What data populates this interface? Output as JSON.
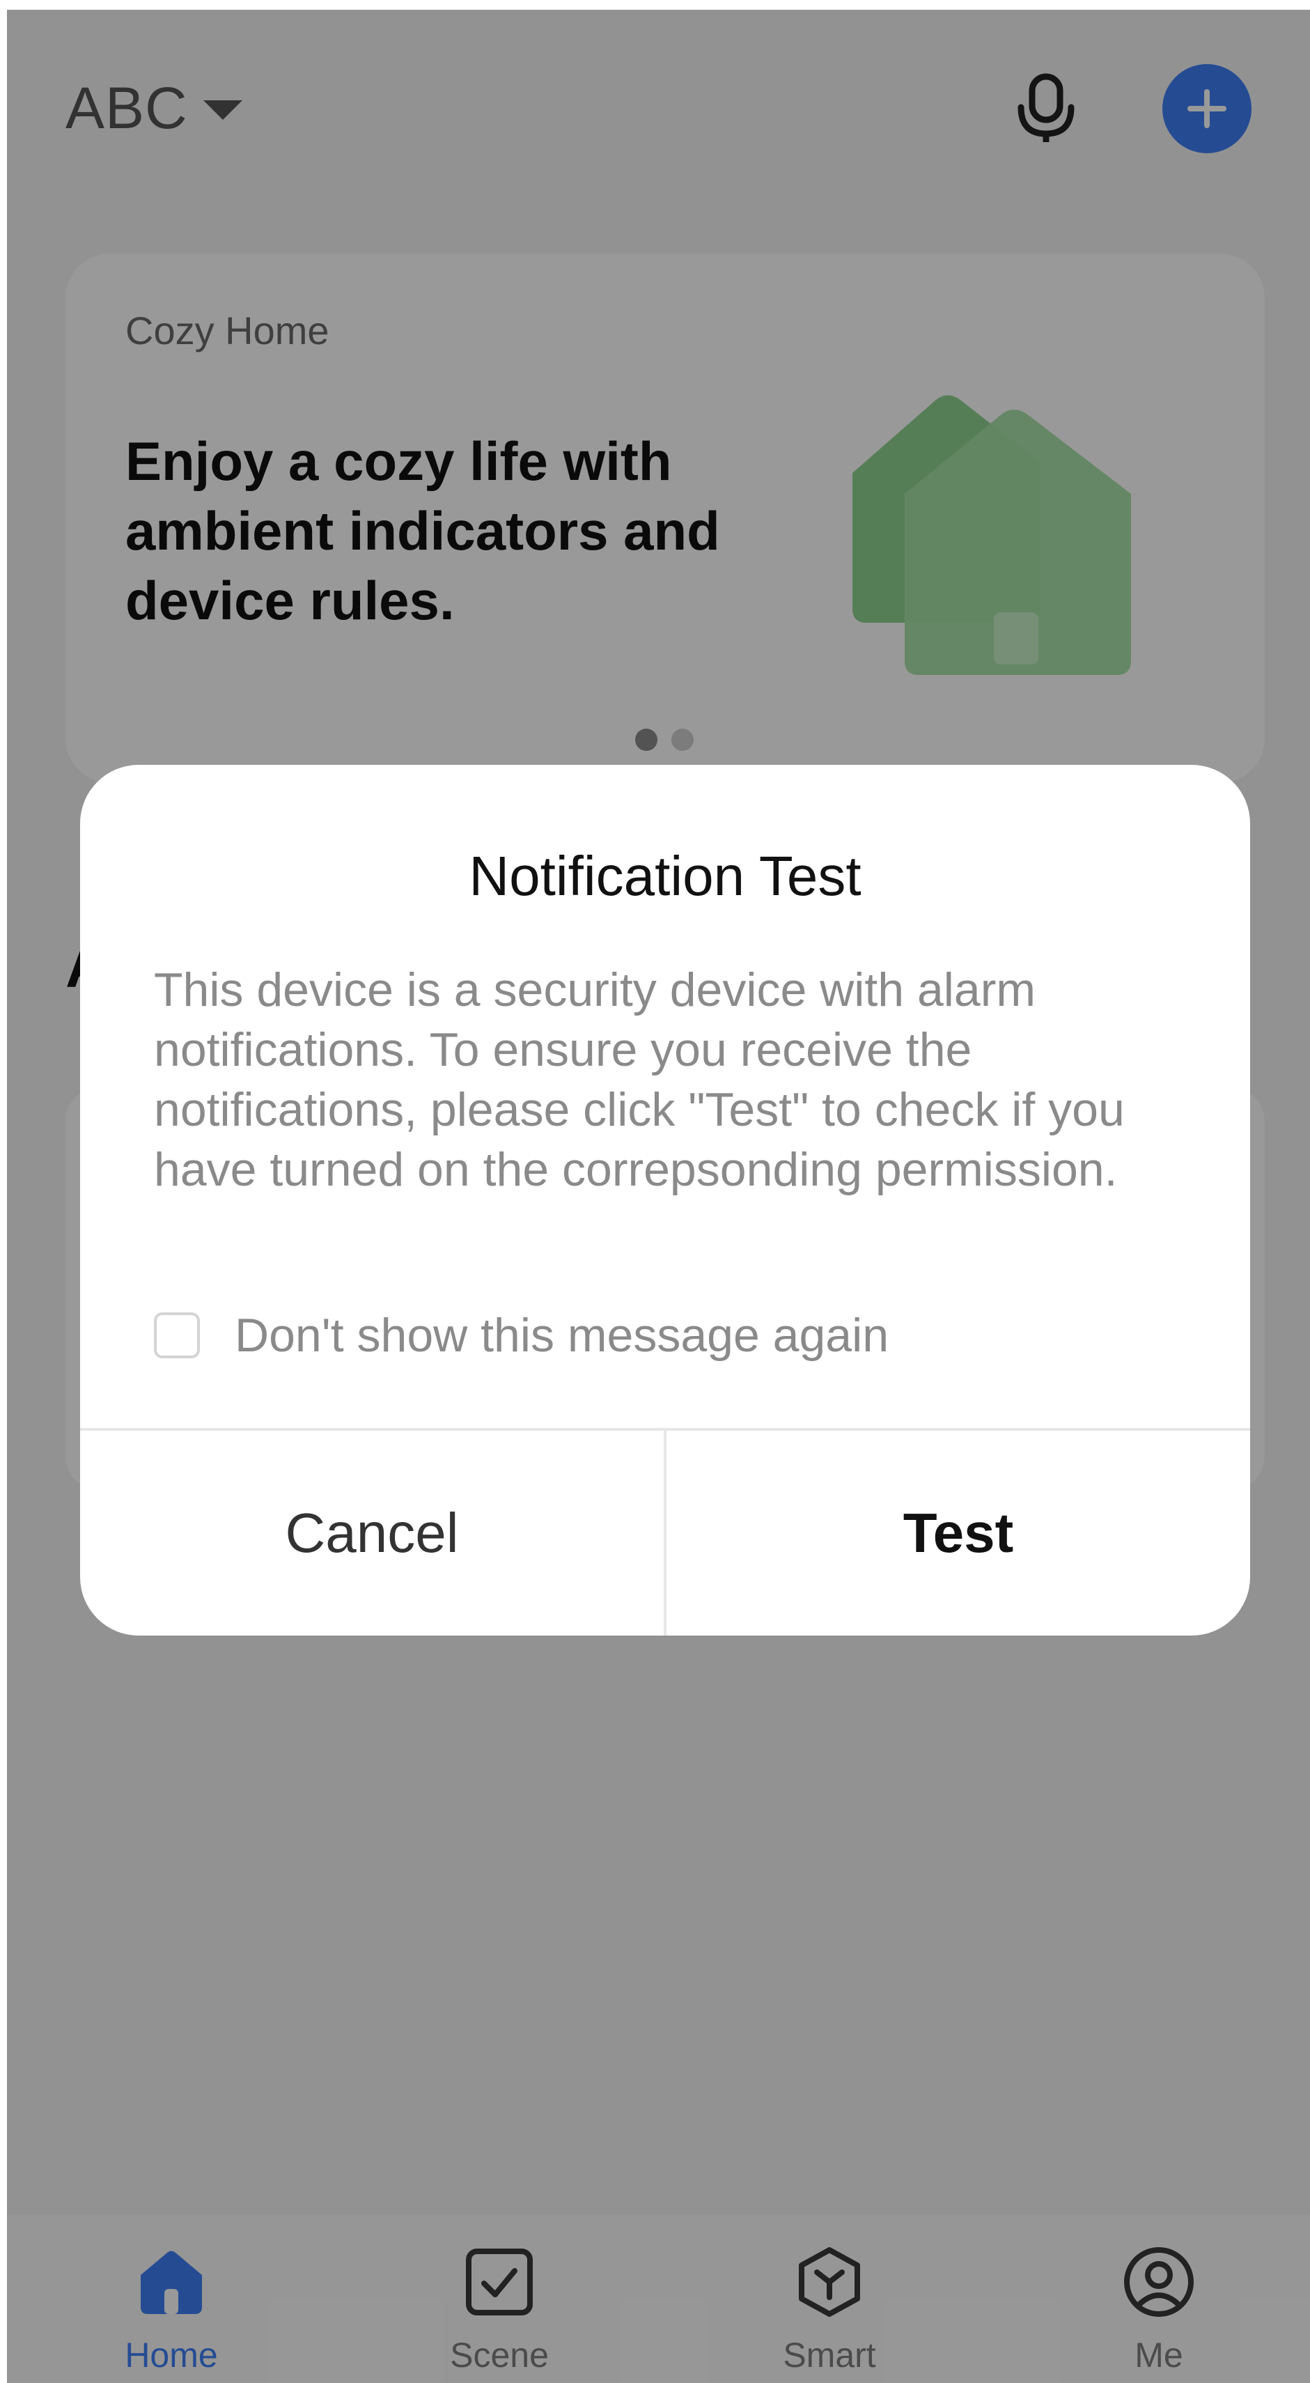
{
  "header": {
    "home_name": "ABC",
    "icons": [
      "caret-down-icon",
      "microphone-icon",
      "plus-icon"
    ],
    "accent_color": "#3f7ff5"
  },
  "banner": {
    "eyebrow": "Cozy Home",
    "headline": "Enjoy a cozy life with ambient indicators and device rules.",
    "illustration": "green-houses-illustration",
    "pager": {
      "total": 2,
      "active_index": 0
    }
  },
  "section": {
    "title": "A"
  },
  "dialog": {
    "title": "Notification Test",
    "body": "This device is a security device with alarm notifications. To ensure you receive the notifications, please click \"Test\" to check if you have turned on the correpsonding permission.",
    "dont_show_label": "Don't show this message again",
    "dont_show_checked": false,
    "cancel_label": "Cancel",
    "test_label": "Test"
  },
  "tabbar": {
    "active": "Home",
    "tabs": [
      {
        "label": "Home",
        "icon": "home-icon"
      },
      {
        "label": "Scene",
        "icon": "scene-checkbox-icon"
      },
      {
        "label": "Smart",
        "icon": "smart-hexagon-icon"
      },
      {
        "label": "Me",
        "icon": "profile-icon"
      }
    ]
  }
}
